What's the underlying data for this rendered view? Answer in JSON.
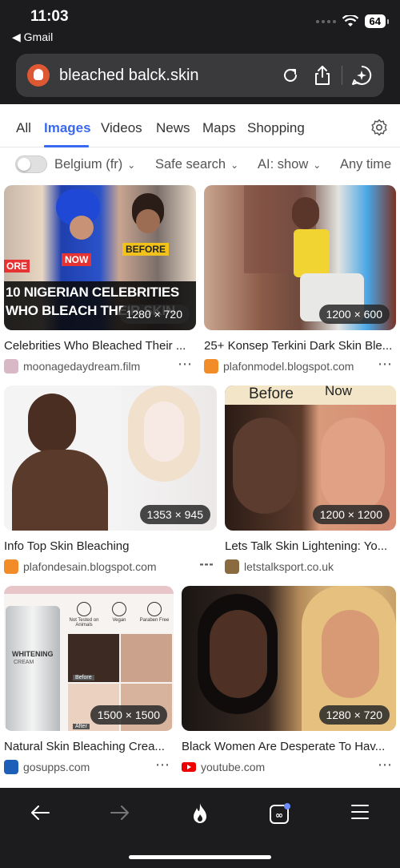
{
  "status": {
    "time": "11:03",
    "back_app": "◀ Gmail",
    "battery": "64"
  },
  "urlbar": {
    "query": "bleached balck.skin"
  },
  "tabs": [
    "All",
    "Images",
    "Videos",
    "News",
    "Maps",
    "Shopping"
  ],
  "filters": {
    "region": "Belgium (fr)",
    "safe_search": "Safe search",
    "ai": "AI: show",
    "time": "Any time"
  },
  "results": [
    {
      "caption": "Celebrities Who Bleached Their ...",
      "source": "moonagedaydream.film",
      "dims": "1280 × 720",
      "overlay_1": "10 NIGERIAN CELEBRITIES",
      "overlay_2": "WHO BLEACH THEIR SKIN",
      "tag_before": "BEFORE",
      "tag_now": "NOW",
      "tag_ore": "ORE"
    },
    {
      "caption": "25+ Konsep Terkini Dark Skin Ble...",
      "source": "plafonmodel.blogspot.com",
      "dims": "1200 × 600"
    },
    {
      "caption": "Info Top Skin Bleaching",
      "source": "plafondesain.blogspot.com",
      "dims": "1353 × 945"
    },
    {
      "caption": "Lets Talk Skin Lightening: Yo...",
      "source": "letstalksport.co.uk",
      "dims": "1200 × 1200",
      "tag_before": "Before",
      "tag_now": "Now"
    },
    {
      "caption": "Natural Skin Bleaching Crea...",
      "source": "gosupps.com",
      "dims": "1500 × 1500",
      "tube_label": "WHITENING",
      "tube_sub": "CREAM",
      "badges": [
        "Not Tested on Animals",
        "Vegan",
        "Paraben Free"
      ],
      "tag_before": "Before",
      "tag_after": "After"
    },
    {
      "caption": "Black Women Are Desperate To Hav...",
      "source": "youtube.com",
      "dims": "1280 × 720"
    }
  ],
  "colors": {
    "accent": "#3969ef",
    "header_bg": "#1c1c1e"
  }
}
